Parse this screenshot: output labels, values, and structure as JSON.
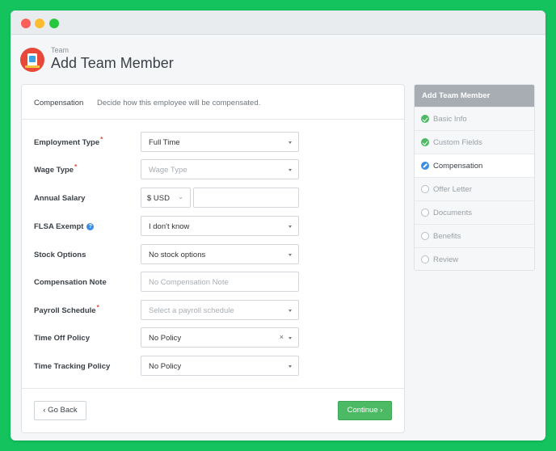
{
  "header": {
    "breadcrumb": "Team",
    "title": "Add Team Member"
  },
  "section": {
    "name": "Compensation",
    "description": "Decide how this employee will be compensated."
  },
  "fields": {
    "employment_type": {
      "label": "Employment Type",
      "required": true,
      "value": "Full Time"
    },
    "wage_type": {
      "label": "Wage Type",
      "required": true,
      "placeholder": "Wage Type"
    },
    "annual_salary": {
      "label": "Annual Salary",
      "currency": "$ USD",
      "value": ""
    },
    "flsa_exempt": {
      "label": "FLSA Exempt",
      "help": "?",
      "value": "I don't know"
    },
    "stock_options": {
      "label": "Stock Options",
      "value": "No stock options"
    },
    "compensation_note": {
      "label": "Compensation Note",
      "placeholder": "No Compensation Note"
    },
    "payroll_schedule": {
      "label": "Payroll Schedule",
      "required": true,
      "placeholder": "Select a payroll schedule"
    },
    "time_off_policy": {
      "label": "Time Off Policy",
      "value": "No Policy",
      "clear": "×"
    },
    "time_tracking_policy": {
      "label": "Time Tracking Policy",
      "value": "No Policy"
    }
  },
  "required_mark": "*",
  "footer": {
    "back_label": "‹  Go Back",
    "continue_label": "Continue  ›"
  },
  "steps": {
    "title": "Add Team Member",
    "items": [
      {
        "label": "Basic Info",
        "state": "done"
      },
      {
        "label": "Custom Fields",
        "state": "done"
      },
      {
        "label": "Compensation",
        "state": "current"
      },
      {
        "label": "Offer Letter",
        "state": "todo"
      },
      {
        "label": "Documents",
        "state": "todo"
      },
      {
        "label": "Benefits",
        "state": "todo"
      },
      {
        "label": "Review",
        "state": "todo"
      }
    ]
  },
  "colors": {
    "accent": "#4cba64",
    "background": "#14c35e",
    "required": "#e4473a",
    "info": "#3a8de6"
  }
}
